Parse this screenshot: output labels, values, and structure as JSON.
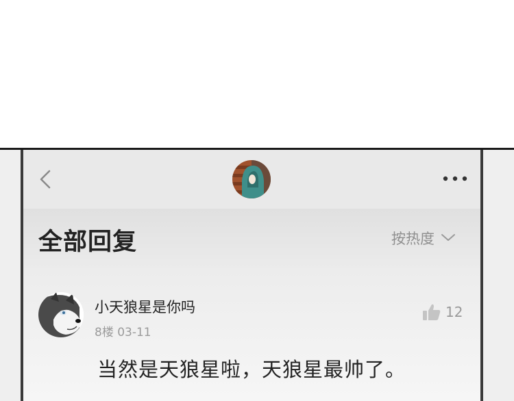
{
  "header": {
    "back_icon": "chevron-left-icon",
    "avatar_icon": "hooded-figure-avatar",
    "more_icon": "ellipsis-icon"
  },
  "section": {
    "title": "全部回复",
    "sort_label": "按热度",
    "sort_icon": "chevron-down-icon"
  },
  "comments": [
    {
      "username": "小天狼星是你吗",
      "meta": "8楼  03-11",
      "likes": "12",
      "text": "当然是天狼星啦，天狼星最帅了。",
      "avatar_icon": "husky-avatar"
    }
  ],
  "colors": {
    "frame": "#3a3a3a",
    "nav_bg": "#e9e9e9",
    "text_primary": "#222222",
    "text_secondary": "#9a9a9a",
    "avatar_teal": "#3f8f8a"
  }
}
